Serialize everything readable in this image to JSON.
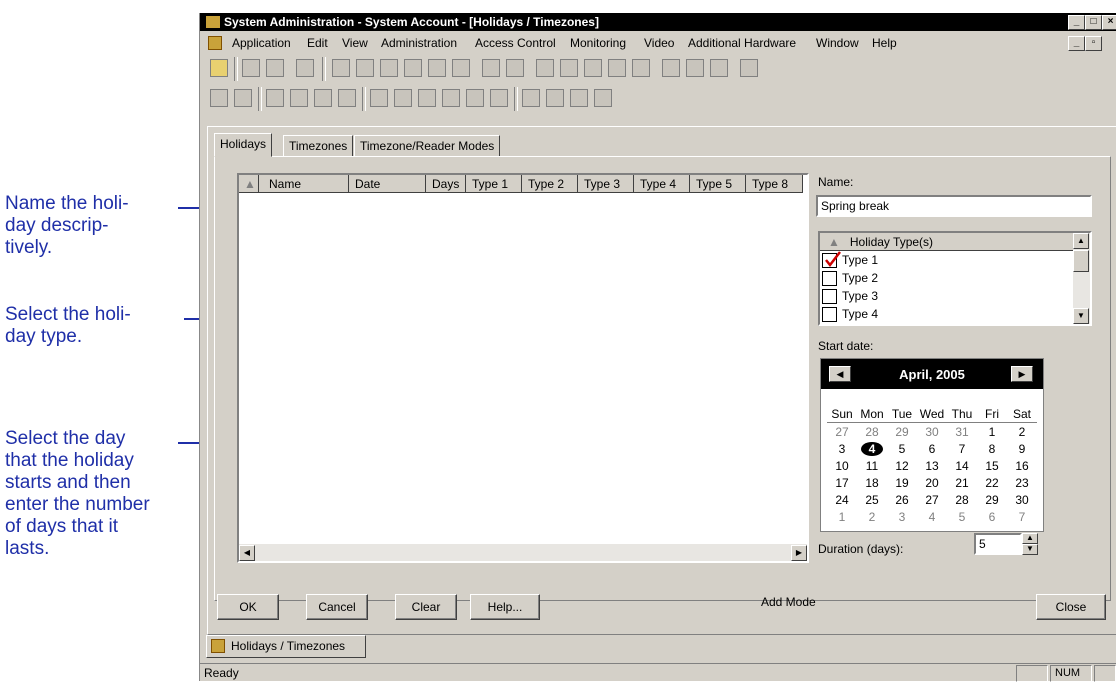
{
  "callouts": [
    {
      "lines": [
        "Name the holi-",
        "day descrip-",
        "tively."
      ]
    },
    {
      "lines": [
        "Select the holi-",
        "day type."
      ]
    },
    {
      "lines": [
        "Select the day",
        "that the holiday",
        "starts and then",
        "enter the number",
        "of days that it",
        "lasts."
      ]
    }
  ],
  "window": {
    "title": "System Administration - System Account - [Holidays / Timezones]",
    "controls": {
      "minimize": "_",
      "maximize": "□",
      "close": "×"
    }
  },
  "menu": [
    "Application",
    "Edit",
    "View",
    "Administration",
    "Access Control",
    "Monitoring",
    "Video",
    "Additional Hardware",
    "Window",
    "Help"
  ],
  "tabs": [
    "Holidays",
    "Timezones",
    "Timezone/Reader Modes"
  ],
  "list": {
    "columns": [
      "Name",
      "Date",
      "Days",
      "Type 1",
      "Type 2",
      "Type 3",
      "Type 4",
      "Type 5",
      "Type 8"
    ]
  },
  "name_label": "Name:",
  "name_value": "Spring break",
  "holiday_types": {
    "header": "Holiday Type(s)",
    "items": [
      {
        "label": "Type 1",
        "checked": true
      },
      {
        "label": "Type 2",
        "checked": false
      },
      {
        "label": "Type 3",
        "checked": false
      },
      {
        "label": "Type 4",
        "checked": false
      }
    ]
  },
  "start_date_label": "Start date:",
  "calendar": {
    "month": "April, 2005",
    "weekdays": [
      "Sun",
      "Mon",
      "Tue",
      "Wed",
      "Thu",
      "Fri",
      "Sat"
    ],
    "weeks": [
      [
        "27",
        "28",
        "29",
        "30",
        "31",
        "1",
        "2"
      ],
      [
        "3",
        "4",
        "5",
        "6",
        "7",
        "8",
        "9"
      ],
      [
        "10",
        "11",
        "12",
        "13",
        "14",
        "15",
        "16"
      ],
      [
        "17",
        "18",
        "19",
        "20",
        "21",
        "22",
        "23"
      ],
      [
        "24",
        "25",
        "26",
        "27",
        "28",
        "29",
        "30"
      ],
      [
        "1",
        "2",
        "3",
        "4",
        "5",
        "6",
        "7"
      ]
    ],
    "selected": "4"
  },
  "duration_label": "Duration (days):",
  "duration_value": "5",
  "buttons": {
    "ok": "OK",
    "cancel": "Cancel",
    "clear": "Clear",
    "help": "Help...",
    "close": "Close"
  },
  "mode": "Add Mode",
  "doc_tab": "Holidays / Timezones",
  "status": {
    "text": "Ready",
    "num": "NUM"
  },
  "colors": {
    "callout": "#1f2fa8",
    "check": "#cc0000"
  }
}
